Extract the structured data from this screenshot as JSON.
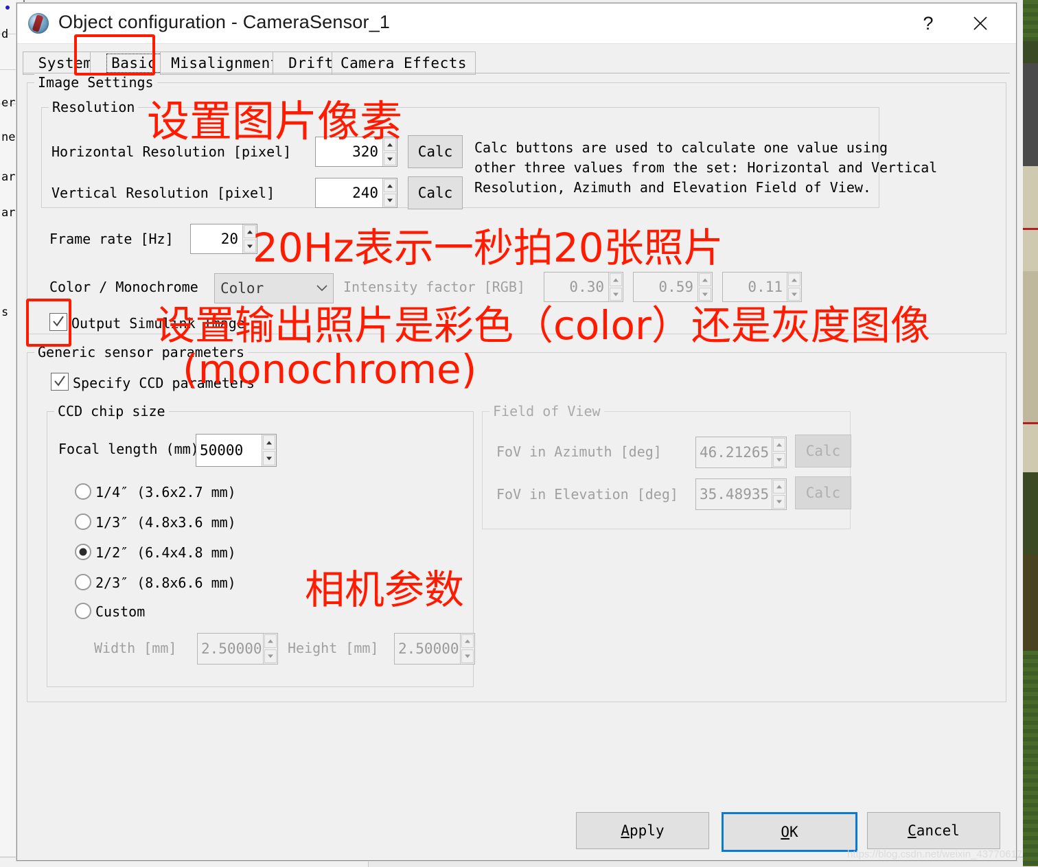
{
  "window": {
    "title": "Object configuration - CameraSensor_1",
    "icon": "camera-sensor-icon",
    "help_button": "?",
    "close_button": "✕"
  },
  "tabs": [
    {
      "label": "System",
      "selected": false
    },
    {
      "label": "Basic",
      "selected": true
    },
    {
      "label": "Misalignment",
      "selected": false
    },
    {
      "label": "Drift",
      "selected": false
    },
    {
      "label": "Camera Effects",
      "selected": false
    }
  ],
  "image_settings": {
    "legend": "Image Settings",
    "resolution": {
      "legend": "Resolution",
      "horizontal_label": "Horizontal Resolution [pixel]",
      "horizontal_value": "320",
      "horizontal_calc": "Calc",
      "vertical_label": "Vertical Resolution [pixel]",
      "vertical_value": "240",
      "vertical_calc": "Calc",
      "help_line1": "Calc buttons are used to calculate one value using",
      "help_line2": "other three values from the set: Horizontal and Vertical",
      "help_line3": "Resolution, Azimuth and Elevation Field of View."
    },
    "frame_rate_label": "Frame rate [Hz]",
    "frame_rate_value": "20",
    "color_mode_label": "Color / Monochrome",
    "color_mode_value": "Color",
    "intensity_label": "Intensity factor [RGB]",
    "intensity_r": "0.30",
    "intensity_g": "0.59",
    "intensity_b": "0.11",
    "output_simulink_label": "Output Simulink Image",
    "output_simulink_checked": true
  },
  "generic_sensor": {
    "legend": "Generic sensor parameters",
    "specify_ccd_label": "Specify CCD parameters",
    "specify_ccd_checked": true,
    "ccd_chip_size": {
      "legend": "CCD chip size",
      "focal_length_label": "Focal length (mm)",
      "focal_length_value": "50000",
      "options": [
        {
          "label": "1/4″ (3.6x2.7 mm)",
          "selected": false
        },
        {
          "label": "1/3″ (4.8x3.6 mm)",
          "selected": false
        },
        {
          "label": "1/2″ (6.4x4.8 mm)",
          "selected": true
        },
        {
          "label": "2/3″ (8.8x6.6 mm)",
          "selected": false
        },
        {
          "label": "Custom",
          "selected": false
        }
      ],
      "width_label": "Width [mm]",
      "width_value": "2.50000",
      "height_label": "Height [mm]",
      "height_value": "2.50000"
    },
    "field_of_view": {
      "legend": "Field of View",
      "azimuth_label": "FoV in Azimuth [deg]",
      "azimuth_value": "46.21265",
      "azimuth_calc": "Calc",
      "elevation_label": "FoV in Elevation [deg]",
      "elevation_value": "35.48935",
      "elevation_calc": "Calc"
    }
  },
  "footer": {
    "apply": "Apply",
    "apply_mnemonic": "A",
    "ok": "OK",
    "ok_mnemonic": "O",
    "cancel": "Cancel",
    "cancel_mnemonic": "C"
  },
  "annotations": [
    {
      "text": "设置图片像素",
      "name": "annotation-set-image-pixels"
    },
    {
      "text": "20Hz表示一秒拍20张照片",
      "name": "annotation-frame-rate"
    },
    {
      "text": "设置输出照片是彩色（color）还是灰度图像",
      "name": "annotation-color-mode-line1"
    },
    {
      "text": "(monochrome)",
      "name": "annotation-color-mode-line2"
    },
    {
      "text": "相机参数",
      "name": "annotation-camera-parameters"
    }
  ],
  "watermark": "https://blog.csdn.net/weixin_43770617",
  "colors": {
    "annotation_red": "#ff1a00",
    "default_button_blue": "#0a7bd4",
    "dialog_bg": "#f0f0f0"
  }
}
